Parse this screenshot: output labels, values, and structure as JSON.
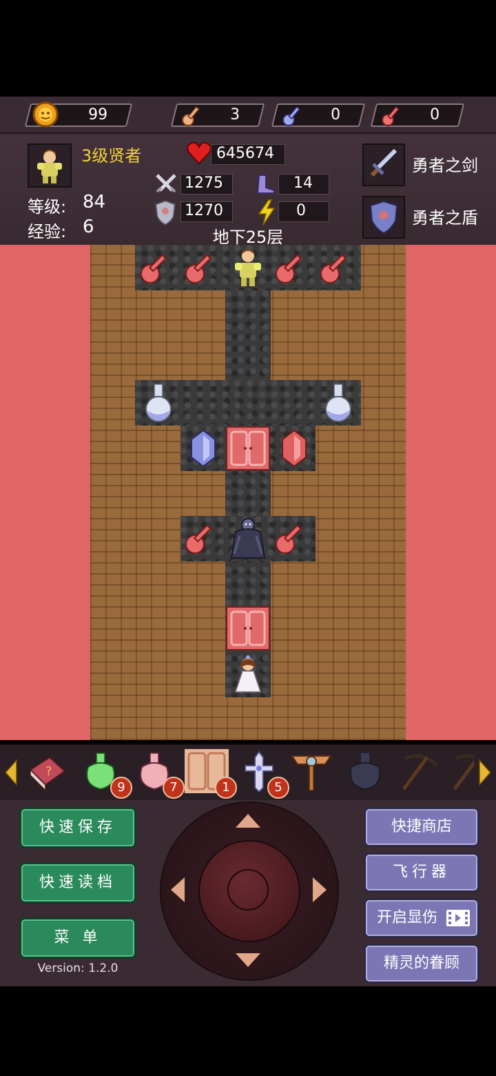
{
  "resources": {
    "gold": "99",
    "yellow_keys": "3",
    "blue_keys": "0",
    "red_keys": "0"
  },
  "hero": {
    "title": "3级贤者",
    "level_label": "等级:",
    "level": "84",
    "exp_label": "经验:",
    "exp": "6",
    "hp": "645674",
    "attack": "1275",
    "defense": "1270",
    "agility": "14",
    "magic": "0"
  },
  "equipment": {
    "weapon": "勇者之剑",
    "shield": "勇者之盾"
  },
  "floor": "地下25层",
  "items": [
    {
      "name": "monster-manual-book-icon",
      "count": ""
    },
    {
      "name": "green-potion-icon",
      "count": "9"
    },
    {
      "name": "pink-potion-icon",
      "count": "7"
    },
    {
      "name": "door-scroll-icon",
      "count": "1"
    },
    {
      "name": "cross-icon",
      "count": "5"
    },
    {
      "name": "winged-staff-icon",
      "count": ""
    },
    {
      "name": "dark-vase-icon",
      "count": ""
    },
    {
      "name": "pickaxe-icon",
      "count": ""
    },
    {
      "name": "pickaxe-icon",
      "count": ""
    }
  ],
  "buttons": {
    "quick_save": "快速保存",
    "quick_load": "快速读档",
    "menu": "菜 单",
    "shop": "快捷商店",
    "fly": "飞行器",
    "show_damage": "开启显伤",
    "spirit": "精灵的眷顾"
  },
  "version": "Version: 1.2.0",
  "colors": {
    "lava": "#e06565",
    "brick": "#9a6a3c",
    "floor": "#3a3a3a",
    "green_button": "#2a8a5c",
    "purple_button": "#7d76b4",
    "title_yellow": "#f2d23a"
  }
}
